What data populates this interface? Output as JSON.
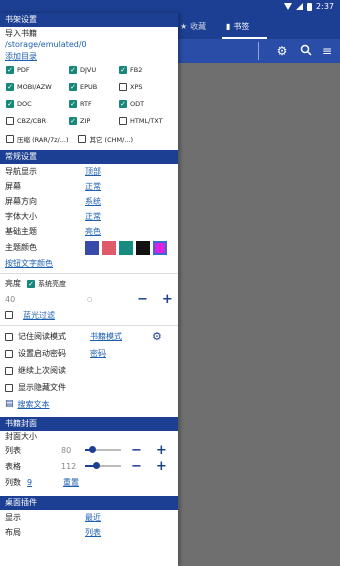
{
  "status": {
    "time": "2:37"
  },
  "topbar": {
    "tabs": [
      {
        "label": "收藏",
        "icon": "star-icon"
      },
      {
        "label": "书签",
        "icon": "bookmark-icon"
      }
    ]
  },
  "drawer": {
    "shelf": {
      "title": "书架设置",
      "import_label": "导入书籍",
      "path": "/storage/emulated/0",
      "add_dir": "添加目录",
      "formats": [
        {
          "label": "PDF",
          "checked": true
        },
        {
          "label": "DJVU",
          "checked": true
        },
        {
          "label": "FB2",
          "checked": true
        },
        {
          "label": "MOBI/AZW",
          "checked": true
        },
        {
          "label": "EPUB",
          "checked": true
        },
        {
          "label": "XPS",
          "checked": false
        },
        {
          "label": "DOC",
          "checked": true
        },
        {
          "label": "RTF",
          "checked": true
        },
        {
          "label": "ODT",
          "checked": true
        },
        {
          "label": "CBZ/CBR",
          "checked": false
        },
        {
          "label": "ZIP",
          "checked": true
        },
        {
          "label": "HTML/TXT",
          "checked": false
        }
      ],
      "archive_label": "压缩 (RAR/7z/...)",
      "other_label": "其它 (CHM/...)"
    },
    "general": {
      "title": "常规设置",
      "nav_label": "导航显示",
      "nav_value": "顶部",
      "screen_label": "屏幕",
      "screen_value": "正常",
      "orient_label": "屏幕方向",
      "orient_value": "系统",
      "fontsize_label": "字体大小",
      "fontsize_value": "正常",
      "theme_label": "基础主题",
      "theme_value": "亮色",
      "color_label": "主题颜色",
      "theme_colors": [
        "#3a4aa8",
        "#e05a6a",
        "#168c80",
        "#111111",
        "#e020e0"
      ],
      "button_text_color": "按钮文字颜色",
      "brightness_label": "亮度",
      "system_brightness": "系统亮度",
      "brightness_value": "40",
      "bluelight": "蓝光过滤"
    },
    "reading": {
      "remember_mode": "记住阅读模式",
      "book_mode": "书籍模式",
      "set_password": "设置启动密码",
      "password": "密码",
      "continue_reading": "继续上次阅读",
      "show_hidden": "显示隐藏文件",
      "search_text": "搜索文本"
    },
    "cover": {
      "title": "书籍封面",
      "size_label": "封面大小",
      "list_label": "列表",
      "list_value": "80",
      "list_level": 0.2,
      "table_label": "表格",
      "table_value": "112",
      "table_level": 0.3,
      "columns_label": "列数",
      "columns_value": "9",
      "reset": "重置"
    },
    "widget": {
      "title": "桌面插件",
      "display_label": "显示",
      "display_value": "最近",
      "layout_label": "布局",
      "layout_value": "列表"
    }
  }
}
